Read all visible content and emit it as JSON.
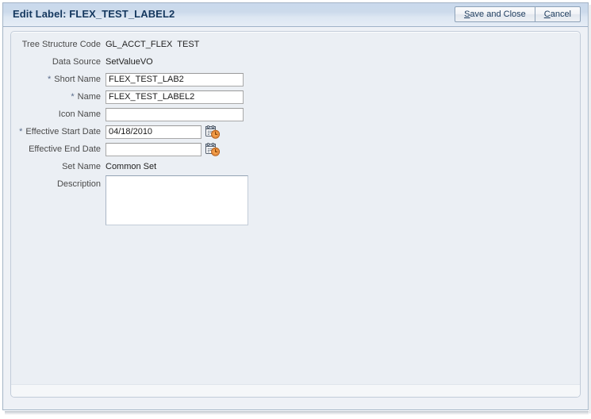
{
  "window": {
    "title": "Edit Label: FLEX_TEST_LABEL2"
  },
  "toolbar": {
    "save_and_close": {
      "accel": "S",
      "rest": "ave and Close"
    },
    "cancel": {
      "accel": "C",
      "rest": "ancel"
    }
  },
  "form": {
    "rows": [
      {
        "label": "Tree Structure Code",
        "required": false,
        "type": "static",
        "value": "GL_ACCT_FLEX  TEST"
      },
      {
        "label": "Data Source",
        "required": false,
        "type": "static",
        "value": "SetValueVO"
      },
      {
        "label": "Short Name",
        "required": true,
        "type": "text",
        "value": "FLEX_TEST_LAB2"
      },
      {
        "label": "Name",
        "required": true,
        "type": "text",
        "value": "FLEX_TEST_LABEL2"
      },
      {
        "label": "Icon Name",
        "required": false,
        "type": "text",
        "value": ""
      },
      {
        "label": "Effective Start Date",
        "required": true,
        "type": "date",
        "value": "04/18/2010"
      },
      {
        "label": "Effective End Date",
        "required": false,
        "type": "date",
        "value": ""
      },
      {
        "label": "Set Name",
        "required": false,
        "type": "static",
        "value": "Common Set"
      },
      {
        "label": "Description",
        "required": false,
        "type": "textarea",
        "value": ""
      }
    ],
    "required_marker": "*"
  },
  "icons": {
    "date_picker": "calendar-clock-icon"
  },
  "colors": {
    "title_text": "#14375e",
    "titlebar_gradient_top": "#c9d9ec",
    "titlebar_gradient_bottom": "#e6edf6",
    "panel_background": "#ebeff4",
    "panel_border": "#c2ccd9",
    "required_asterisk": "#5a6d8c",
    "clock_accent": "#e07b2a"
  }
}
